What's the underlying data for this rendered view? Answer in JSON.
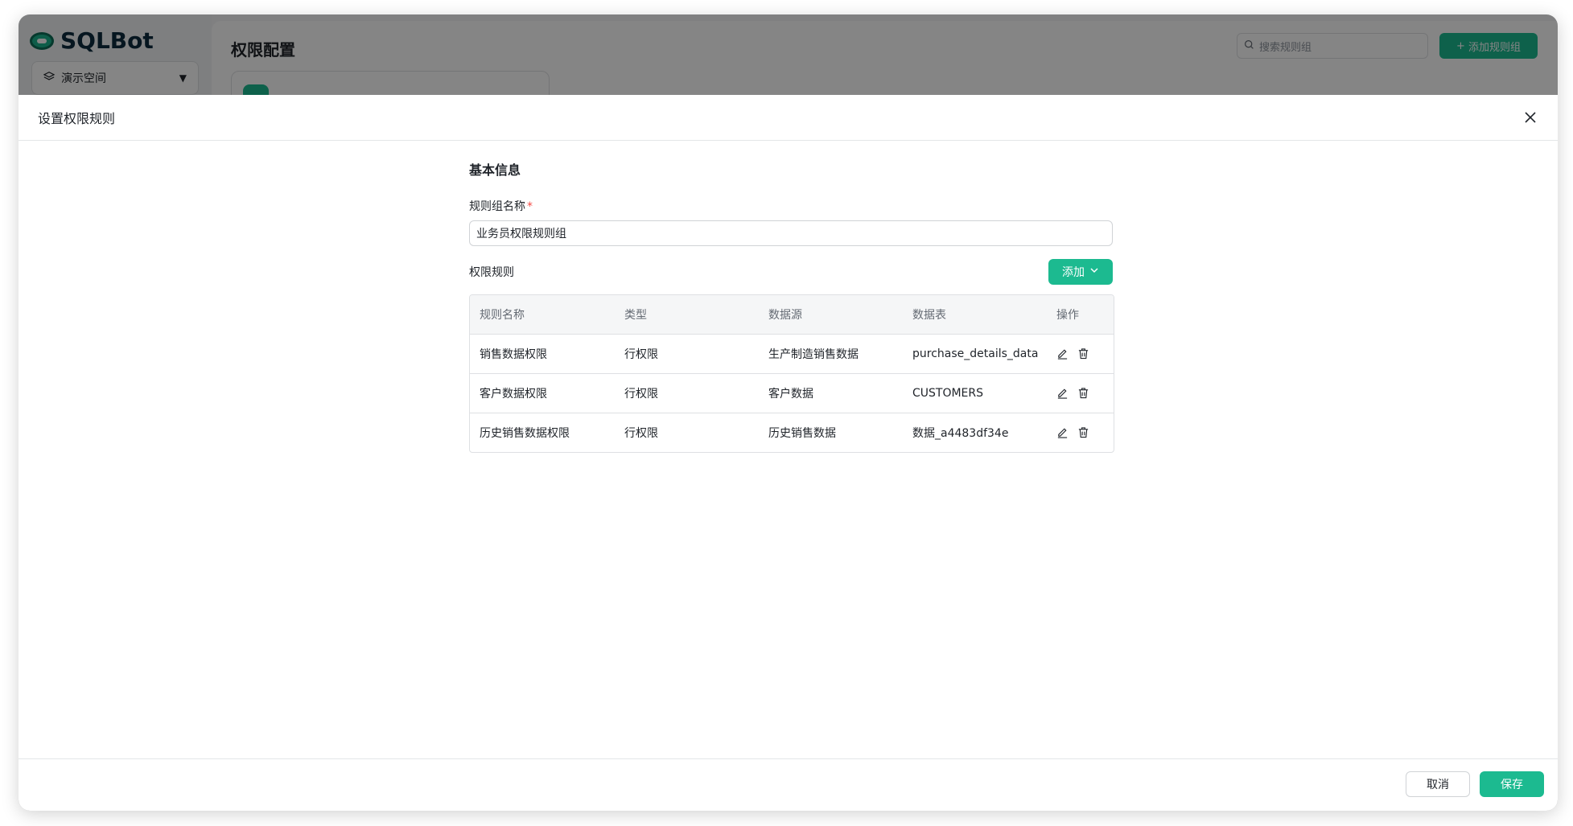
{
  "app": {
    "name": "SQLBot",
    "workspace": "演示空间"
  },
  "background": {
    "page_title": "权限配置",
    "search_placeholder": "搜索规则组",
    "add_group_label": "添加规则组"
  },
  "drawer": {
    "title": "设置权限规则",
    "section_title": "基本信息",
    "name_label": "规则组名称",
    "name_required": "*",
    "name_value": "业务员权限规则组",
    "rules_label": "权限规则",
    "add_label": "添加",
    "table": {
      "columns": [
        "规则名称",
        "类型",
        "数据源",
        "数据表",
        "操作"
      ],
      "rows": [
        [
          "销售数据权限",
          "行权限",
          "生产制造销售数据",
          "purchase_details_data"
        ],
        [
          "客户数据权限",
          "行权限",
          "客户数据",
          "CUSTOMERS"
        ],
        [
          "历史销售数据权限",
          "行权限",
          "历史销售数据",
          "数据_a4483df34e"
        ]
      ]
    },
    "cancel_label": "取消",
    "save_label": "保存"
  },
  "colors": {
    "accent": "#1cba90",
    "required": "#f54a45",
    "overlay": "rgba(0,0,0,0.48)"
  },
  "icons": [
    "layers-icon",
    "caret-down-icon",
    "search-icon",
    "plus-icon",
    "close-icon",
    "chevron-down-icon",
    "edit-icon",
    "delete-icon"
  ]
}
